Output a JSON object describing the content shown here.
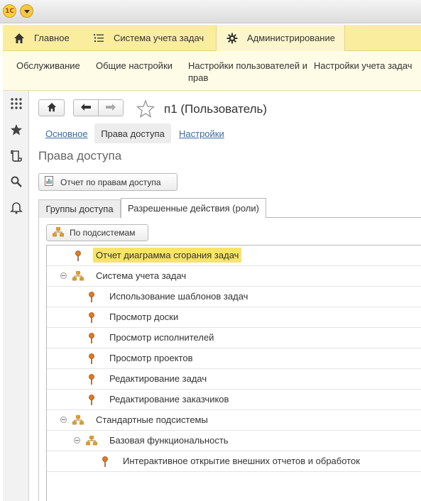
{
  "titlebar": {
    "logo_text": "1С"
  },
  "sections": [
    {
      "label": "Главное",
      "icon": "home-icon"
    },
    {
      "label": "Система учета задач",
      "icon": "task-list-icon"
    },
    {
      "label": "Администрирование",
      "icon": "gear-icon"
    }
  ],
  "submenu": [
    "Обслуживание",
    "Общие настройки",
    "Настройки пользователей и прав",
    "Настройки учета задач"
  ],
  "leftnav": [
    "apps-grid-icon",
    "star-icon",
    "history-icon",
    "search-icon",
    "bell-icon"
  ],
  "form": {
    "title": "п1 (Пользователь)",
    "links": {
      "main": "Основное",
      "access": "Права доступа",
      "settings": "Настройки"
    },
    "section_title": "Права доступа",
    "report_button": "Отчет по правам доступа",
    "tabs": {
      "groups": "Группы доступа",
      "roles": "Разрешенные действия (роли)"
    },
    "subsystems_button": "По подсистемам"
  },
  "tree": [
    {
      "label": "Отчет диаграмма сгорания задач",
      "kind": "role",
      "level": 0,
      "highlighted": true
    },
    {
      "label": "Система учета задач",
      "kind": "subsystem",
      "level": 0,
      "expanded": true
    },
    {
      "label": "Использование шаблонов задач",
      "kind": "role",
      "level": 1
    },
    {
      "label": "Просмотр доски",
      "kind": "role",
      "level": 1
    },
    {
      "label": "Просмотр исполнителей",
      "kind": "role",
      "level": 1
    },
    {
      "label": "Просмотр проектов",
      "kind": "role",
      "level": 1
    },
    {
      "label": "Редактирование задач",
      "kind": "role",
      "level": 1
    },
    {
      "label": "Редактирование заказчиков",
      "kind": "role",
      "level": 1
    },
    {
      "label": "Стандартные подсистемы",
      "kind": "subsystem",
      "level": 0,
      "expanded": true
    },
    {
      "label": "Базовая функциональность",
      "kind": "subsystem",
      "level": 1,
      "expanded": true
    },
    {
      "label": "Интерактивное открытие внешних отчетов и обработок",
      "kind": "role",
      "level": 2
    }
  ],
  "colors": {
    "sections_bg": "#fbed9e",
    "submenu_bg": "#fefbe6",
    "highlight": "#f8e36b",
    "link": "#3a6aa6"
  }
}
